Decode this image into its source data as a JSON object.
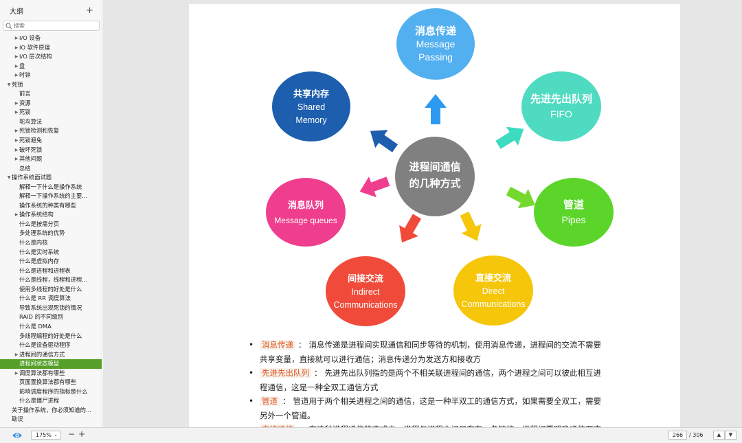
{
  "sidebar": {
    "title": "大纲",
    "add_label": "+",
    "search_placeholder": "搜索",
    "items": [
      {
        "label": "I/O 设备",
        "level": 1,
        "toggle": "▶"
      },
      {
        "label": "IO 软件原理",
        "level": 1,
        "toggle": "▶"
      },
      {
        "label": "I/O 层次结构",
        "level": 1,
        "toggle": "▶"
      },
      {
        "label": "盘",
        "level": 1,
        "toggle": "▶"
      },
      {
        "label": "时钟",
        "level": 1,
        "toggle": "▶"
      },
      {
        "label": "死锁",
        "level": 0,
        "toggle": "▼"
      },
      {
        "label": "前言",
        "level": 1,
        "toggle": ""
      },
      {
        "label": "资源",
        "level": 1,
        "toggle": "▶"
      },
      {
        "label": "死锁",
        "level": 1,
        "toggle": "▶"
      },
      {
        "label": "鸵鸟算法",
        "level": 1,
        "toggle": ""
      },
      {
        "label": "死锁检测和恢复",
        "level": 1,
        "toggle": "▶"
      },
      {
        "label": "死锁避免",
        "level": 1,
        "toggle": "▶"
      },
      {
        "label": "破坏死锁",
        "level": 1,
        "toggle": "▶"
      },
      {
        "label": "其他问题",
        "level": 1,
        "toggle": "▶"
      },
      {
        "label": "总结",
        "level": 1,
        "toggle": ""
      },
      {
        "label": "操作系统面试题",
        "level": 0,
        "toggle": "▼"
      },
      {
        "label": "解释一下什么是操作系统",
        "level": 1,
        "toggle": ""
      },
      {
        "label": "解释一下操作系统的主要...",
        "level": 1,
        "toggle": ""
      },
      {
        "label": "操作系统的种类有哪些",
        "level": 1,
        "toggle": ""
      },
      {
        "label": "操作系统结构",
        "level": 1,
        "toggle": "▶"
      },
      {
        "label": "什么是按需分页",
        "level": 1,
        "toggle": ""
      },
      {
        "label": "多处理系统的优势",
        "level": 1,
        "toggle": ""
      },
      {
        "label": "什么是内核",
        "level": 1,
        "toggle": ""
      },
      {
        "label": "什么是实时系统",
        "level": 1,
        "toggle": ""
      },
      {
        "label": "什么是虚拟内存",
        "level": 1,
        "toggle": ""
      },
      {
        "label": "什么是进程和进程表",
        "level": 1,
        "toggle": ""
      },
      {
        "label": "什么是线程，线程和进程...",
        "level": 1,
        "toggle": ""
      },
      {
        "label": "使用多线程的好处是什么",
        "level": 1,
        "toggle": ""
      },
      {
        "label": "什么是 RR 调度算法",
        "level": 1,
        "toggle": ""
      },
      {
        "label": "导致系统出现死锁的情况",
        "level": 1,
        "toggle": ""
      },
      {
        "label": "RAID 的不同级别",
        "level": 1,
        "toggle": ""
      },
      {
        "label": "什么是 DMA",
        "level": 1,
        "toggle": ""
      },
      {
        "label": "多线程编程的好处是什么",
        "level": 1,
        "toggle": ""
      },
      {
        "label": "什么是设备驱动程序",
        "level": 1,
        "toggle": ""
      },
      {
        "label": "进程间的通信方式",
        "level": 1,
        "toggle": "▶"
      },
      {
        "label": "进程间状态模型",
        "level": 1,
        "toggle": "",
        "selected": true
      },
      {
        "label": "调度算法都有哪些",
        "level": 1,
        "toggle": "▶"
      },
      {
        "label": "页面置换算法都有哪些",
        "level": 1,
        "toggle": ""
      },
      {
        "label": "影响调度程序的指标是什么",
        "level": 1,
        "toggle": ""
      },
      {
        "label": "什么是僵尸进程",
        "level": 1,
        "toggle": ""
      },
      {
        "label": "关于操作系统，你必须知道的...",
        "level": 0,
        "toggle": ""
      },
      {
        "label": "勘误",
        "level": 0,
        "toggle": ""
      }
    ]
  },
  "diagram": {
    "center": {
      "line1": "进程间通信",
      "line2": "的几种方式",
      "color": "#808080"
    },
    "bubbles": [
      {
        "key": "message_passing",
        "zh": "消息传递",
        "en1": "Message",
        "en2": "Passing",
        "color": "#53b0f0"
      },
      {
        "key": "fifo",
        "zh": "先进先出队列",
        "en1": "FIFO",
        "en2": "",
        "color": "#4fdbc1"
      },
      {
        "key": "pipes",
        "zh": "管道",
        "en1": "Pipes",
        "en2": "",
        "color": "#5bd52a"
      },
      {
        "key": "direct",
        "zh": "直接交流",
        "en1": "Direct",
        "en2": "Communications",
        "color": "#f5c60a"
      },
      {
        "key": "indirect",
        "zh": "间接交流",
        "en1": "Indirect",
        "en2": "Communications",
        "color": "#f04b3a"
      },
      {
        "key": "message_queues",
        "zh": "消息队列",
        "en1": "Message queues",
        "en2": "",
        "color": "#ef3e8e"
      },
      {
        "key": "shared_memory",
        "zh": "共享内存",
        "en1": "Shared",
        "en2": "Memory",
        "color": "#1d5fae"
      }
    ],
    "arrow_colors": {
      "message_passing": "#2b9af0",
      "fifo": "#3ddbc0",
      "pipes": "#74d82e",
      "direct": "#f5c60a",
      "indirect": "#f04b3a",
      "message_queues": "#ef3e8e",
      "shared_memory": "#1d5fae"
    }
  },
  "notes": [
    {
      "term": "消息传递",
      "text": "消息传递是进程间实现通信和同步等待的机制，使用消息传递，进程间的交流不需要",
      "cont": "共享变量，直接就可以进行通信；消息传递分为发送方和接收方"
    },
    {
      "term": "先进先出队列",
      "text": "先进先出队列指的是两个不相关联进程间的通信，两个进程之间可以彼此相互进",
      "cont": "程通信，这是一种全双工通信方式"
    },
    {
      "term": "管道",
      "text": "管道用于两个相关进程之间的通信，这是一种半双工的通信方式，如果需要全双工，需要",
      "cont": "另外一个管道。"
    },
    {
      "term": "直接通信",
      "text": "在这种进程通信的方式中，进程与进程之间只存在一条链接，进程间要明确通信双方",
      "cont": ""
    }
  ],
  "statusbar": {
    "zoom": "175%",
    "zoom_out": "−",
    "zoom_in": "+",
    "page_current": "266",
    "page_total": "/ 306",
    "prev": "▲",
    "next": "▼"
  },
  "colors": {
    "selected_bg": "#56a02a",
    "term_color": "#e0531a"
  }
}
